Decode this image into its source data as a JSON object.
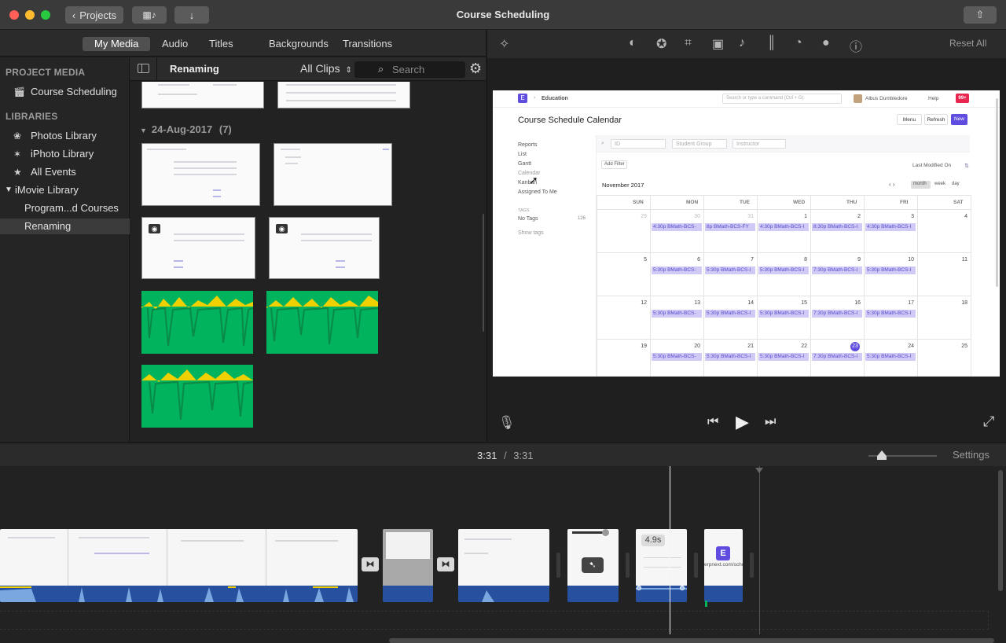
{
  "window": {
    "title": "Course Scheduling",
    "projects_label": "Projects"
  },
  "media_tabs": [
    "My Media",
    "Audio",
    "Titles",
    "Backgrounds",
    "Transitions"
  ],
  "sidebar": {
    "project_media_header": "PROJECT MEDIA",
    "project_item": "Course Scheduling",
    "libraries_header": "LIBRARIES",
    "libraries": [
      "Photos Library",
      "iPhoto Library",
      "All Events"
    ],
    "imovie_library": "iMovie Library",
    "events": [
      "Program...d Courses",
      "Renaming"
    ]
  },
  "browser": {
    "title": "Renaming",
    "filter": "All Clips",
    "search_placeholder": "Search",
    "date_header": "24-Aug-2017",
    "date_count": "(7)"
  },
  "viewer_toolbar": {
    "reset_all": "Reset All"
  },
  "preview": {
    "brand_letter": "E",
    "breadcrumb": "Education",
    "search_placeholder": "Search or type a command (Ctrl + G)",
    "user": "Albus Dumbledore",
    "help": "Help",
    "badge": "99+",
    "page_title": "Course Schedule Calendar",
    "menu_btn": "Menu",
    "refresh_btn": "Refresh",
    "new_btn": "New",
    "side_links": [
      "Reports",
      "List",
      "Gantt",
      "Calendar",
      "Kanban",
      "Assigned To Me"
    ],
    "tags_header": "TAGS",
    "no_tags": "No Tags",
    "no_tags_count": "126",
    "show_tags": "Show tags",
    "filters": [
      "ID",
      "Student Group",
      "Instructor"
    ],
    "add_filter": "Add Filter",
    "last_modified": "Last Modified On",
    "month_label": "November 2017",
    "views": [
      "month",
      "week",
      "day"
    ],
    "days": [
      "SUN",
      "MON",
      "TUE",
      "WED",
      "THU",
      "FRI",
      "SAT"
    ],
    "weeks": [
      [
        "29",
        "30",
        "31",
        "1",
        "2",
        "3",
        "4"
      ],
      [
        "5",
        "6",
        "7",
        "8",
        "9",
        "10",
        "11"
      ],
      [
        "12",
        "13",
        "14",
        "15",
        "16",
        "17",
        "18"
      ],
      [
        "19",
        "20",
        "21",
        "22",
        "23",
        "24",
        "25"
      ]
    ],
    "events": [
      [
        "",
        "4:30p BMath-BCS-",
        "8p BMath-BCS-FY",
        "4:30p BMath-BCS-I",
        "8:30p BMath-BCS-I",
        "4:30p BMath-BCS-I",
        ""
      ],
      [
        "",
        "5:30p BMath-BCS-",
        "5:30p BMath-BCS-I",
        "5:30p BMath-BCS-I",
        "7:30p BMath-BCS-I",
        "5:30p BMath-BCS-I",
        ""
      ],
      [
        "",
        "5:30p BMath-BCS-",
        "5:30p BMath-BCS-I",
        "5:30p BMath-BCS-I",
        "7:30p BMath-BCS-I",
        "5:30p BMath-BCS-I",
        ""
      ],
      [
        "",
        "5:30p BMath-BCS-",
        "5:30p BMath-BCS-I",
        "5:30p BMath-BCS-I",
        "7:30p BMath-BCS-I",
        "5:30p BMath-BCS-I",
        ""
      ]
    ]
  },
  "timeline": {
    "time_current": "3:31",
    "time_sep": "/",
    "time_total": "3:31",
    "settings": "Settings",
    "clip_duration": "4.9s",
    "title_clip_text": "erpnext.com/school"
  },
  "colors": {
    "accent": "#5e4ddf",
    "audio_green": "#00b35c",
    "audio_blue": "#27509e",
    "badge_red": "#e8254e"
  }
}
